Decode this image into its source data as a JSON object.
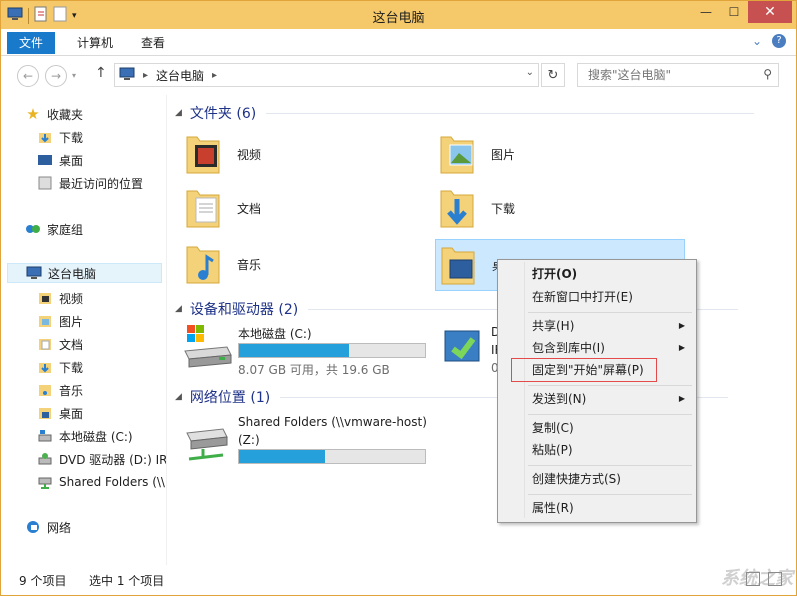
{
  "window": {
    "title": "这台电脑",
    "accent_color": "#f5c86a",
    "controls": [
      "minimize-icon",
      "maximize-icon",
      "close-icon"
    ],
    "control_glyphs": [
      "—",
      "☐",
      "✕"
    ]
  },
  "ribbon": {
    "tabs": [
      "文件",
      "计算机",
      "查看"
    ],
    "file_tab_color": "#1979ca"
  },
  "address": {
    "path": [
      "这台电脑"
    ],
    "search_placeholder": "搜索\"这台电脑\""
  },
  "nav": {
    "favorites": {
      "label": "收藏夹",
      "items": [
        "下载",
        "桌面",
        "最近访问的位置"
      ]
    },
    "homegroup": "家庭组",
    "this_pc": {
      "label": "这台电脑",
      "items": [
        "视频",
        "图片",
        "文档",
        "下载",
        "音乐",
        "桌面",
        "本地磁盘 (C:)",
        "DVD 驱动器 (D:) IR",
        "Shared Folders (\\\\"
      ]
    },
    "network": "网络"
  },
  "content": {
    "folders_group": "文件夹 (6)",
    "folders": [
      "视频",
      "图片",
      "文档",
      "下载",
      "音乐",
      "桌面"
    ],
    "devices_group": "设备和驱动器 (2)",
    "local_disk": {
      "name": "本地磁盘 (C:)",
      "free_text": "8.07 GB 可用，共 19.6 GB",
      "used_fraction": 0.59
    },
    "dvd": {
      "name_partial": "D",
      "line2": "IR",
      "line3": "0"
    },
    "network_group": "网络位置 (1)",
    "shared": {
      "name": "Shared Folders (\\\\vmware-host)",
      "line2": "(Z:)",
      "used_fraction": 0.46
    }
  },
  "status": {
    "items": "9 个项目",
    "selected": "选中 1 个项目"
  },
  "context_menu": {
    "items": [
      "打开(O)",
      "在新窗口中打开(E)",
      "共享(H)",
      "包含到库中(I)",
      "固定到\"开始\"屏幕(P)",
      "发送到(N)",
      "复制(C)",
      "粘贴(P)",
      "创建快捷方式(S)",
      "属性(R)"
    ]
  },
  "watermark": "系统之家"
}
